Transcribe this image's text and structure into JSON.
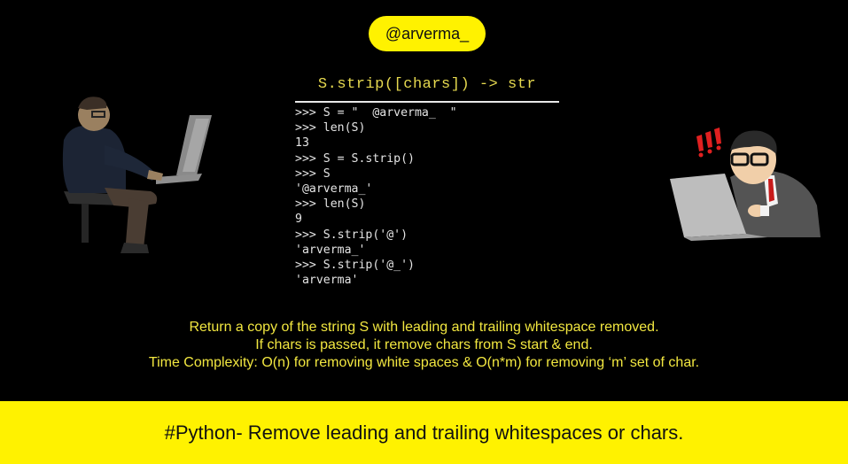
{
  "handle": "@arverma_",
  "signature": "S.strip([chars]) -> str",
  "code_lines": [
    ">>> S = \"  @arverma_  \"",
    ">>> len(S)",
    "13",
    ">>> S = S.strip()",
    ">>> S",
    "'@arverma_'",
    ">>> len(S)",
    "9",
    ">>> S.strip('@')",
    "'arverma_'",
    ">>> S.strip('@_')",
    "'arverma'"
  ],
  "description": [
    "Return a copy of the string S with leading and trailing whitespace removed.",
    "If chars is passed, it remove chars from S start & end.",
    "Time Complexity: O(n) for removing white spaces & O(n*m) for removing ‘m’ set of char."
  ],
  "footer_title": "#Python- Remove leading and trailing whitespaces or chars.",
  "colors": {
    "accent_yellow": "#fff200",
    "text_yellow": "#f2e740",
    "background": "#000000"
  }
}
